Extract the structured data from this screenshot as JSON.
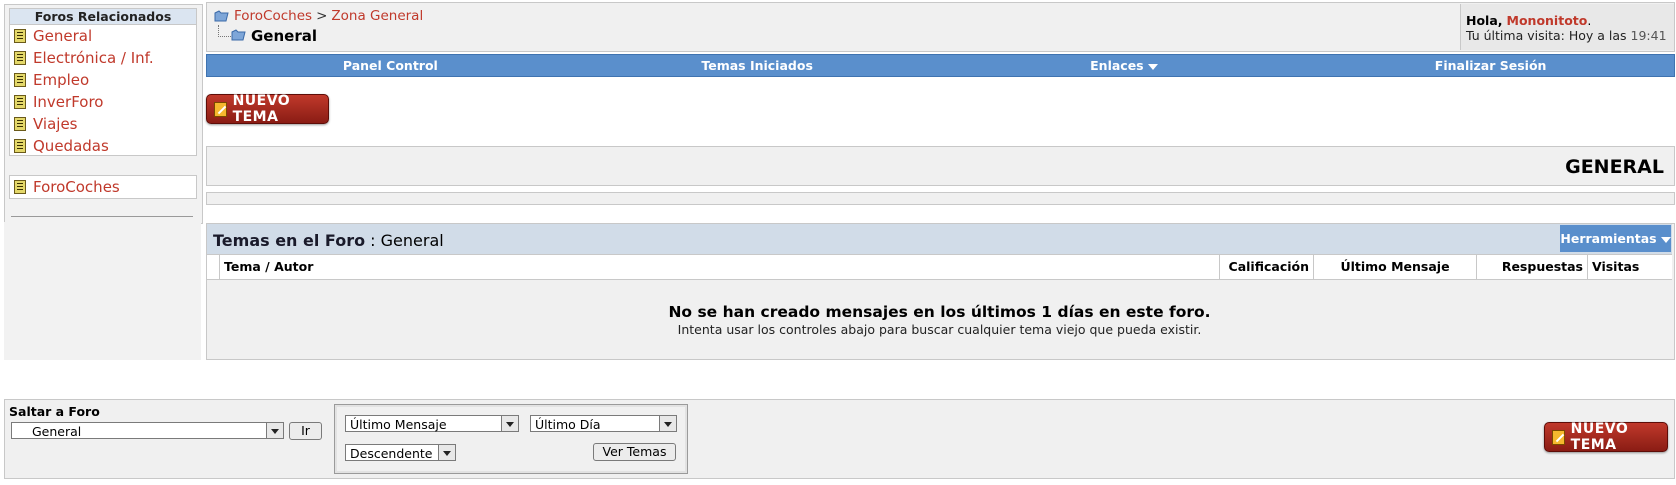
{
  "sidebar": {
    "title": "Foros Relacionados",
    "items": [
      {
        "label": "General",
        "icon": "forum-icon"
      },
      {
        "label": "Electrónica / Inf.",
        "icon": "forum-icon"
      },
      {
        "label": "Empleo",
        "icon": "forum-icon"
      },
      {
        "label": "InverForo",
        "icon": "forum-icon"
      },
      {
        "label": "Viajes",
        "icon": "forum-icon"
      },
      {
        "label": "Quedadas",
        "icon": "forum-icon"
      }
    ],
    "parent": {
      "label": "ForoCoches",
      "icon": "forum-icon"
    }
  },
  "breadcrumb": {
    "root": "ForoCoches",
    "separator": ">",
    "zone": "Zona General",
    "current": "General"
  },
  "user": {
    "greeting": "Hola,",
    "name": "Mononitoto",
    "period": ".",
    "last_visit_label": "Tu última visita: Hoy a las",
    "last_visit_time": "19:41"
  },
  "navbar": {
    "items": [
      "Panel Control",
      "Temas Iniciados",
      "Enlaces",
      "Finalizar Sesión"
    ]
  },
  "new_topic_label": "NUEVO TEMA",
  "forum_title": "GENERAL",
  "threads": {
    "title_bold": "Temas en el Foro",
    "title_rest": ": General",
    "tools_label": "Herramientas",
    "columns": [
      "Tema / Autor",
      "Calificación",
      "Último Mensaje",
      "Respuestas",
      "Visitas"
    ],
    "empty_message": "No se han creado mensajes en los últimos 1 días en este foro.",
    "empty_hint": "Intenta usar los controles abajo para buscar cualquier tema viejo que pueda existir."
  },
  "footer": {
    "jump_label": "Saltar a Foro",
    "jump_value": "General",
    "go_label": "Ir",
    "sort_value": "Último Mensaje",
    "days_value": "Último Día",
    "order_value": "Descendente",
    "view_label": "Ver Temas"
  },
  "colors": {
    "link": "#c0392b",
    "navbar": "#5a8fcc",
    "header_bg": "#f0f0f0",
    "threads_head": "#d1dce8"
  }
}
